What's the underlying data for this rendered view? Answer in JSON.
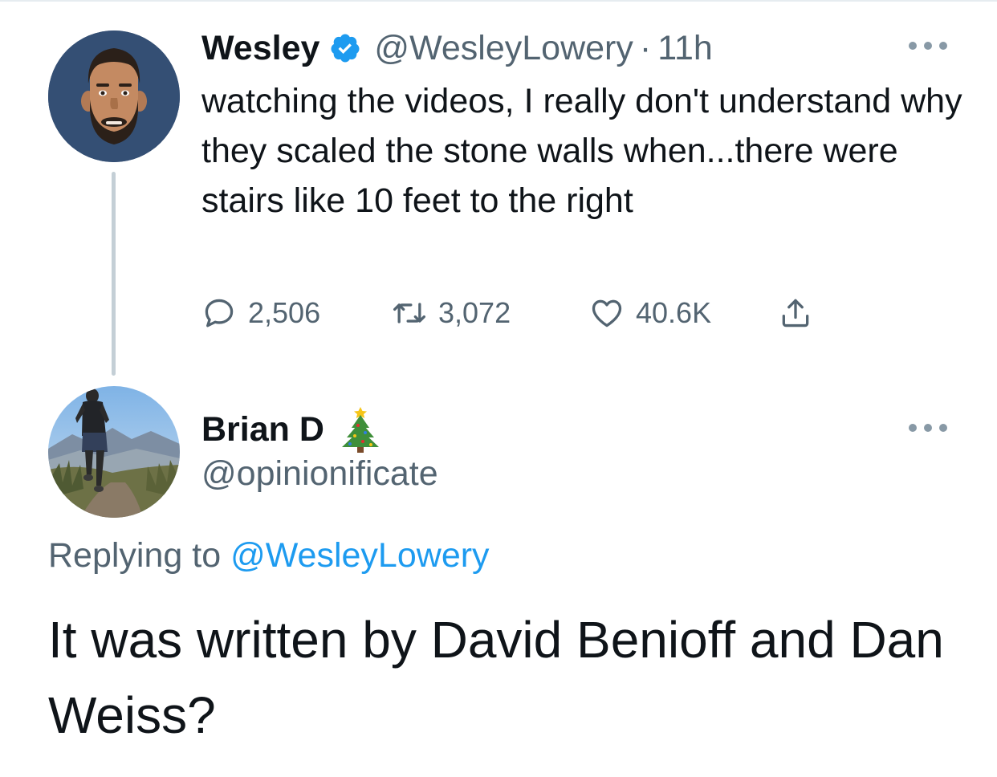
{
  "tweet": {
    "author_name": "Wesley",
    "author_handle": "@WesleyLowery",
    "separator": "·",
    "time": "11h",
    "verified_icon": "verified-badge-icon",
    "text": "watching the videos, I really don't understand why they scaled the stone walls when...there were stairs like 10 feet to the right",
    "actions": {
      "reply_count": "2,506",
      "retweet_count": "3,072",
      "like_count": "40.6K"
    }
  },
  "reply": {
    "author_name": "Brian D",
    "name_emoji_icon": "christmas-tree-icon",
    "author_handle": "@opinionificate",
    "replying_prefix": "Replying to",
    "replying_to": "@WesleyLowery",
    "text": "It was written by David Benioff and Dan Weiss?"
  },
  "colors": {
    "primary_text": "#0f1419",
    "secondary_text": "#536471",
    "link": "#1d9bf0",
    "thread_line": "#c4cfd6"
  }
}
